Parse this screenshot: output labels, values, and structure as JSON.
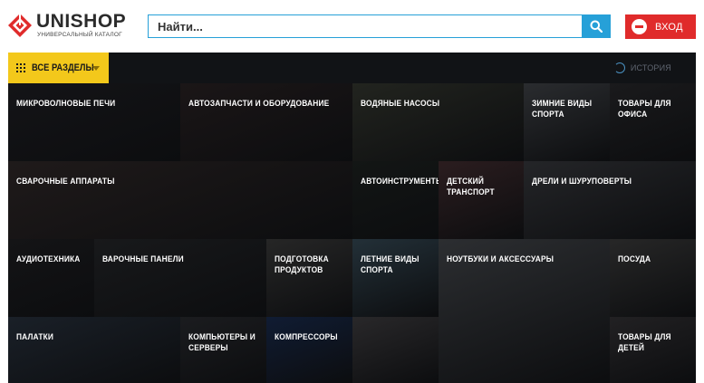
{
  "brand": {
    "name": "UNISHOP",
    "tagline": "УНИВЕРСАЛЬНЫЙ КАТАЛОГ",
    "accent": "#e02b2b"
  },
  "search": {
    "placeholder": "Найти...",
    "value": "",
    "button_icon": "search-icon",
    "color": "#26a0d8"
  },
  "login": {
    "label": "ВХОД",
    "icon": "login-icon",
    "color": "#e02b2b"
  },
  "nav": {
    "sections_label": "ВСЕ РАЗДЕЛЫ",
    "sections_color": "#f3c81b",
    "history_label": "ИСТОРИЯ",
    "history_icon": "history-icon"
  },
  "categories": [
    {
      "name": "МИКРОВОЛНОВЫЕ ПЕЧИ",
      "bg": "#141417"
    },
    {
      "name": "АВТОЗАПЧАСТИ И ОБОРУДОВАНИЕ",
      "bg": "#1b1617"
    },
    {
      "name": "ВОДЯНЫЕ НАСОСЫ",
      "bg": "#22241f"
    },
    {
      "name": "ЗИМНИЕ ВИДЫ\nСПОРТА",
      "bg": "#2a2c2f"
    },
    {
      "name": "ТОВАРЫ ДЛЯ\nОФИСА",
      "bg": "#1a1a1c"
    },
    {
      "name": "СВАРОЧНЫЕ АППАРАТЫ",
      "bg": "#1f1a1a"
    },
    {
      "name": "АВТОИНСТРУМЕНТЫ",
      "bg": "#131615"
    },
    {
      "name": "ДЕТСКИЙ\nТРАНСПОРТ",
      "bg": "#2b1d1f"
    },
    {
      "name": "ДРЕЛИ И ШУРУПОВЕРТЫ",
      "bg": "#242528"
    },
    {
      "name": "АУДИОТЕХНИКА",
      "bg": "#141416"
    },
    {
      "name": "ВАРОЧНЫЕ ПАНЕЛИ",
      "bg": "#18191b"
    },
    {
      "name": "ПОДГОТОВКА\nПРОДУКТОВ",
      "bg": "#262626"
    },
    {
      "name": "ЛЕТНИЕ ВИДЫ\nСПОРТА",
      "bg": "#233038"
    },
    {
      "name": "НОУТБУКИ И АКСЕССУАРЫ",
      "bg": "#2c2e31"
    },
    {
      "name": "ПОСУДА",
      "bg": "#272727"
    },
    {
      "name": "ПАЛАТКИ",
      "bg": "#1a2028"
    },
    {
      "name": "КОМПЬЮТЕРЫ И\nСЕРВЕРЫ",
      "bg": "#1b1c1f"
    },
    {
      "name": "КОМПРЕССОРЫ",
      "bg": "#101c33"
    },
    {
      "name": "",
      "bg": "#29282a"
    },
    {
      "name": "ТОВАРЫ ДЛЯ\nДЕТЕЙ",
      "bg": "#222123"
    }
  ]
}
